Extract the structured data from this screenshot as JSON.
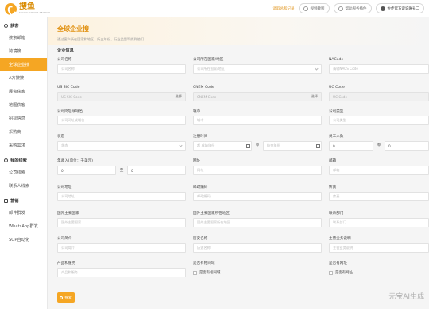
{
  "brand": {
    "name": "搜鱼",
    "tagline": "SOUYU GROUP·SEARCH"
  },
  "topbar": {
    "link": "调取总和记录",
    "btn1": "视频教程",
    "btn2": "帮助服务插件",
    "btn3": "佐佳官方说说账号二"
  },
  "sidebar": {
    "group1": {
      "label": "获客",
      "items": [
        "搜索邮箱",
        "跨境搜",
        "全球企业搜",
        "A方搜搜",
        "展会获客",
        "地图获客",
        "招标信息",
        "采购商",
        "采购需求"
      ]
    },
    "group2": {
      "label": "我的线索",
      "items": [
        "公司线索",
        "联系人线索"
      ]
    },
    "group3": {
      "label": "营销",
      "items": [
        "邮件群发",
        "WhatsApp群发",
        "SOP自动化"
      ]
    }
  },
  "header": {
    "title": "全球企业搜",
    "subtitle": "通过客户所在国家和地区、所立年份、行业类型等找到他们"
  },
  "section": "企业信息",
  "fields": {
    "company_name": {
      "label": "公司名称",
      "placeholder": "公司名称"
    },
    "country": {
      "label": "公司所在国家/地区",
      "placeholder": "公司所在国家/地区"
    },
    "naics": {
      "label": "NACode",
      "placeholder": "请输NACS Code"
    },
    "us_sic": {
      "label": "US SIC Code",
      "placeholder": "US SIC Code",
      "btn": "选择"
    },
    "cnem": {
      "label": "CNEM Code",
      "placeholder": "CNEM Code",
      "btn": "选择"
    },
    "uc": {
      "label": "UC Code",
      "placeholder": "UC Code"
    },
    "website": {
      "label": "公司网址或域名",
      "placeholder": "公司网址或域名"
    },
    "city": {
      "label": "城市",
      "placeholder": "城市"
    },
    "type": {
      "label": "公司类型",
      "placeholder": "公司类型"
    },
    "state": {
      "label": "状态",
      "placeholder": "状态"
    },
    "founded": {
      "label": "注册时间",
      "from": "起 成始年份",
      "sep": "至",
      "to": "结束年份"
    },
    "employees": {
      "label": "员工人数",
      "from": "0",
      "sep": "至",
      "to": "0"
    },
    "revenue": {
      "label": "年收入(单位：千美元)",
      "from": "0",
      "sep": "至",
      "to": "0"
    },
    "url": {
      "label": "网址",
      "placeholder": "网址"
    },
    "email": {
      "label": "邮箱",
      "placeholder": "邮箱"
    },
    "address": {
      "label": "公司地址",
      "placeholder": "公司地址"
    },
    "postcode": {
      "label": "邮政编码",
      "placeholder": "邮政编码"
    },
    "phone": {
      "label": "传真",
      "placeholder": "传真"
    },
    "hq_country": {
      "label": "国外主要国家",
      "placeholder": "国外主要国家"
    },
    "hq_region": {
      "label": "国外主要国家所在地区",
      "placeholder": "国外主要国家所在地区"
    },
    "contact": {
      "label": "联系部门",
      "placeholder": "联系部门"
    },
    "intro": {
      "label": "公司简介",
      "placeholder": "公司简介"
    },
    "history": {
      "label": "历史名称",
      "placeholder": "历史名称"
    },
    "products_main": {
      "label": "主营业务说明",
      "placeholder": "主营业务说明"
    },
    "product_tag": {
      "label": "产品和服务",
      "placeholder": "产品和服务"
    },
    "has_phone": {
      "label": "是否有相同域",
      "check": "是否有相同域"
    },
    "has_site": {
      "label": "是否有网址",
      "check": "是否有网址"
    }
  },
  "search_button": "搜索",
  "watermark": "元宝AI生成"
}
